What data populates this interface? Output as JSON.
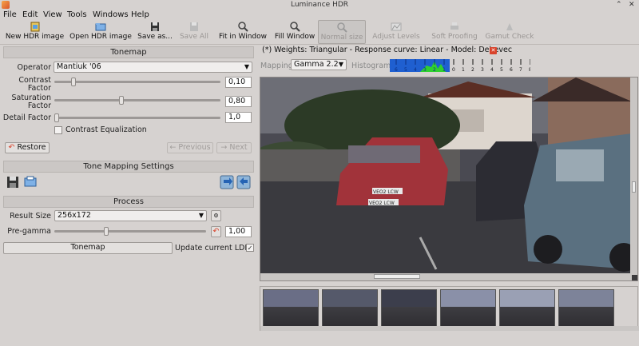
{
  "window": {
    "title": "Luminance HDR"
  },
  "menu": {
    "file": "File",
    "edit": "Edit",
    "view": "View",
    "tools": "Tools",
    "windows": "Windows",
    "help": "Help"
  },
  "toolbar": {
    "new_hdr": "New HDR image",
    "open_hdr": "Open HDR image",
    "save_as": "Save as...",
    "save_all": "Save All",
    "fit_window": "Fit in Window",
    "fill_window": "Fill Window",
    "normal_size": "Normal size",
    "adjust_levels": "Adjust Levels",
    "soft_proofing": "Soft Proofing",
    "gamut_check": "Gamut Check"
  },
  "tonemap": {
    "header": "Tonemap",
    "operator_label": "Operator",
    "operator_value": "Mantiuk '06",
    "contrast_label_1": "Contrast",
    "contrast_label_2": "Factor",
    "contrast_value": "0,10",
    "saturation_label_1": "Saturation",
    "saturation_label_2": "Factor",
    "saturation_value": "0,80",
    "detail_label": "Detail Factor",
    "detail_value": "1,0",
    "contrast_eq_label": "Contrast Equalization",
    "restore": "Restore",
    "previous": "Previous",
    "next": "Next"
  },
  "settings": {
    "header": "Tone Mapping Settings"
  },
  "process": {
    "header": "Process",
    "result_size_label": "Result Size",
    "result_size_value": "256x172",
    "pregamma_label": "Pre-gamma",
    "pregamma_value": "1,00",
    "tonemap_button": "Tonemap",
    "update_ldr_label": "Update current LDR"
  },
  "viewer": {
    "tab_title": "(*) Weights: Triangular - Response curve: Linear - Model: Debevec",
    "mapping_label": "Mapping:",
    "mapping_value": "Gamma 2.2",
    "histogram_label": "Histogram",
    "histogram_ticks": [
      "6",
      "5",
      "4",
      "3",
      "2",
      "1",
      "0",
      "1",
      "2",
      "3",
      "4",
      "5",
      "6",
      "7",
      "8"
    ],
    "plate_1": "VEO2 LCW",
    "plate_2": "VEO2 LCW"
  },
  "colors": {
    "accent_blue": "#1f5fd0",
    "histogram_green": "#2fd02f",
    "close_red": "#d9432b"
  }
}
